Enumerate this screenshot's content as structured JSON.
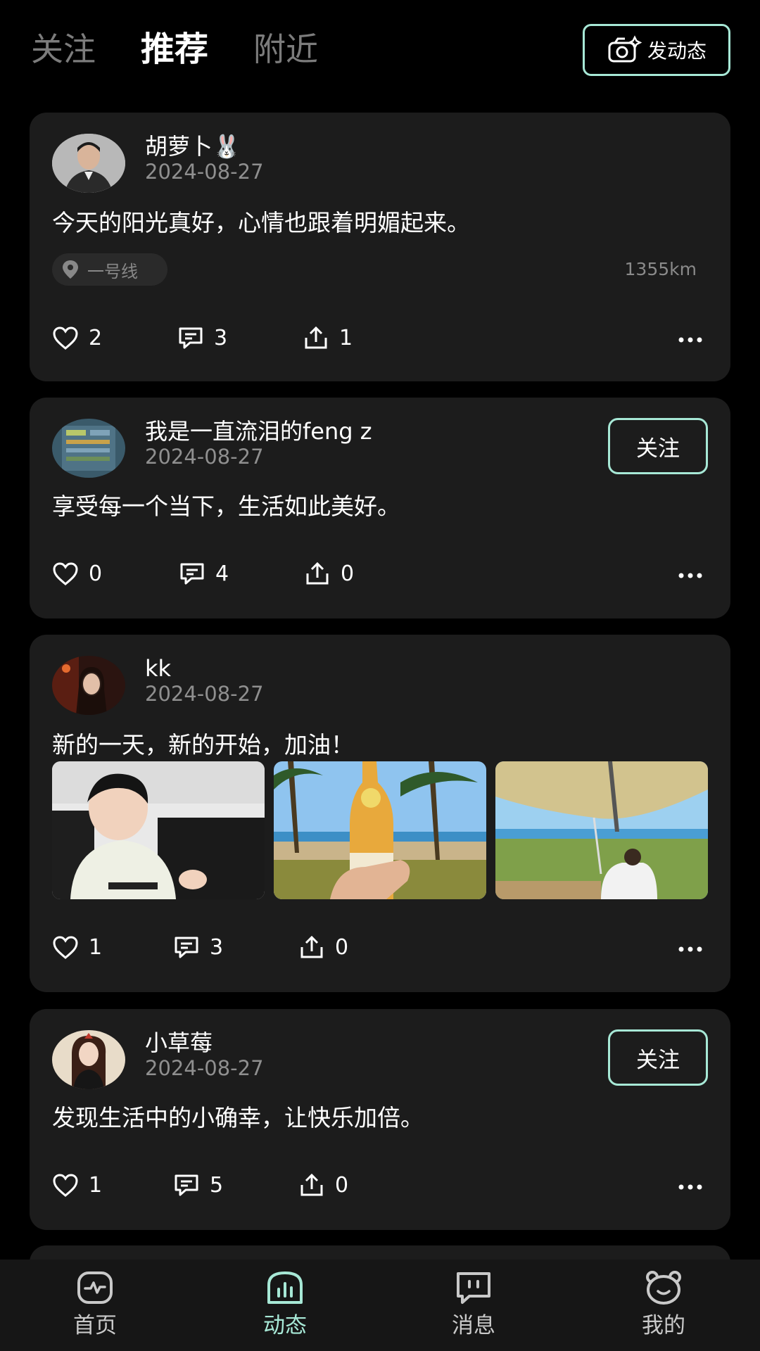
{
  "header": {
    "tabs": [
      {
        "label": "关注"
      },
      {
        "label": "推荐"
      },
      {
        "label": "附近"
      }
    ],
    "active_tab": "推荐",
    "post_button_label": "发动态"
  },
  "posts": [
    {
      "author": "胡萝卜🐰",
      "date": "2024-08-27",
      "text": "今天的阳光真好，心情也跟着明媚起来。",
      "location": "一号线",
      "distance": "1355km",
      "likes": "2",
      "comments": "3",
      "shares": "1"
    },
    {
      "author": "我是一直流泪的feng z",
      "date": "2024-08-27",
      "text": "享受每一个当下，生活如此美好。",
      "follow_label": "关注",
      "likes": "0",
      "comments": "4",
      "shares": "0"
    },
    {
      "author": "kk",
      "date": "2024-08-27",
      "text": "新的一天，新的开始，加油！",
      "likes": "1",
      "comments": "3",
      "shares": "0"
    },
    {
      "author": "小草莓",
      "date": "2024-08-27",
      "text": "发现生活中的小确幸，让快乐加倍。",
      "follow_label": "关注",
      "likes": "1",
      "comments": "5",
      "shares": "0"
    }
  ],
  "bottom_nav": [
    {
      "label": "首页",
      "icon": "pulse-icon"
    },
    {
      "label": "动态",
      "icon": "chart-bars-icon"
    },
    {
      "label": "消息",
      "icon": "message-icon"
    },
    {
      "label": "我的",
      "icon": "bear-face-icon"
    }
  ],
  "active_nav": "动态",
  "colors": {
    "accent": "#a7e8d6",
    "card_bg": "#1c1c1c",
    "page_bg": "#000000"
  }
}
